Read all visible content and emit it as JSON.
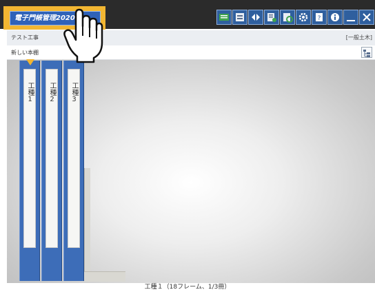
{
  "app": {
    "logo_text": "電子門帳管理2020"
  },
  "toolbar": {
    "buttons": [
      {
        "name": "list-view-button",
        "icon": "list-icon",
        "color": "#3fa34d"
      },
      {
        "name": "print-button",
        "icon": "printer-icon",
        "color": "#e9eef5"
      },
      {
        "name": "move-button",
        "icon": "arrows-icon",
        "color": "#ffffff"
      },
      {
        "name": "document-button",
        "icon": "document-icon",
        "color": "#e9eef5"
      },
      {
        "name": "refresh-button",
        "icon": "refresh-icon",
        "color": "#e9eef5"
      },
      {
        "name": "settings-button",
        "icon": "gear-icon",
        "color": "#ffffff"
      },
      {
        "name": "help-button",
        "icon": "help-icon",
        "color": "#ffffff"
      },
      {
        "name": "info-button",
        "icon": "info-icon",
        "color": "#ffffff"
      },
      {
        "name": "minimize-button",
        "icon": "minimize-icon",
        "color": "#ffffff"
      },
      {
        "name": "close-button",
        "icon": "close-icon",
        "color": "#ffffff"
      }
    ]
  },
  "subheader": {
    "project_name": "テスト工事",
    "category": "[一般土木]"
  },
  "toolbar2": {
    "new_binder_label": "新しい本棚"
  },
  "binders": [
    {
      "label": "工種1"
    },
    {
      "label": "工種2"
    },
    {
      "label": "工種3"
    }
  ],
  "status": {
    "text": "工種１（18フレーム、1/3冊）"
  },
  "colors": {
    "accent": "#f2b632",
    "binder_blue": "#3d6db8",
    "titlebar": "#2b2b2b"
  }
}
